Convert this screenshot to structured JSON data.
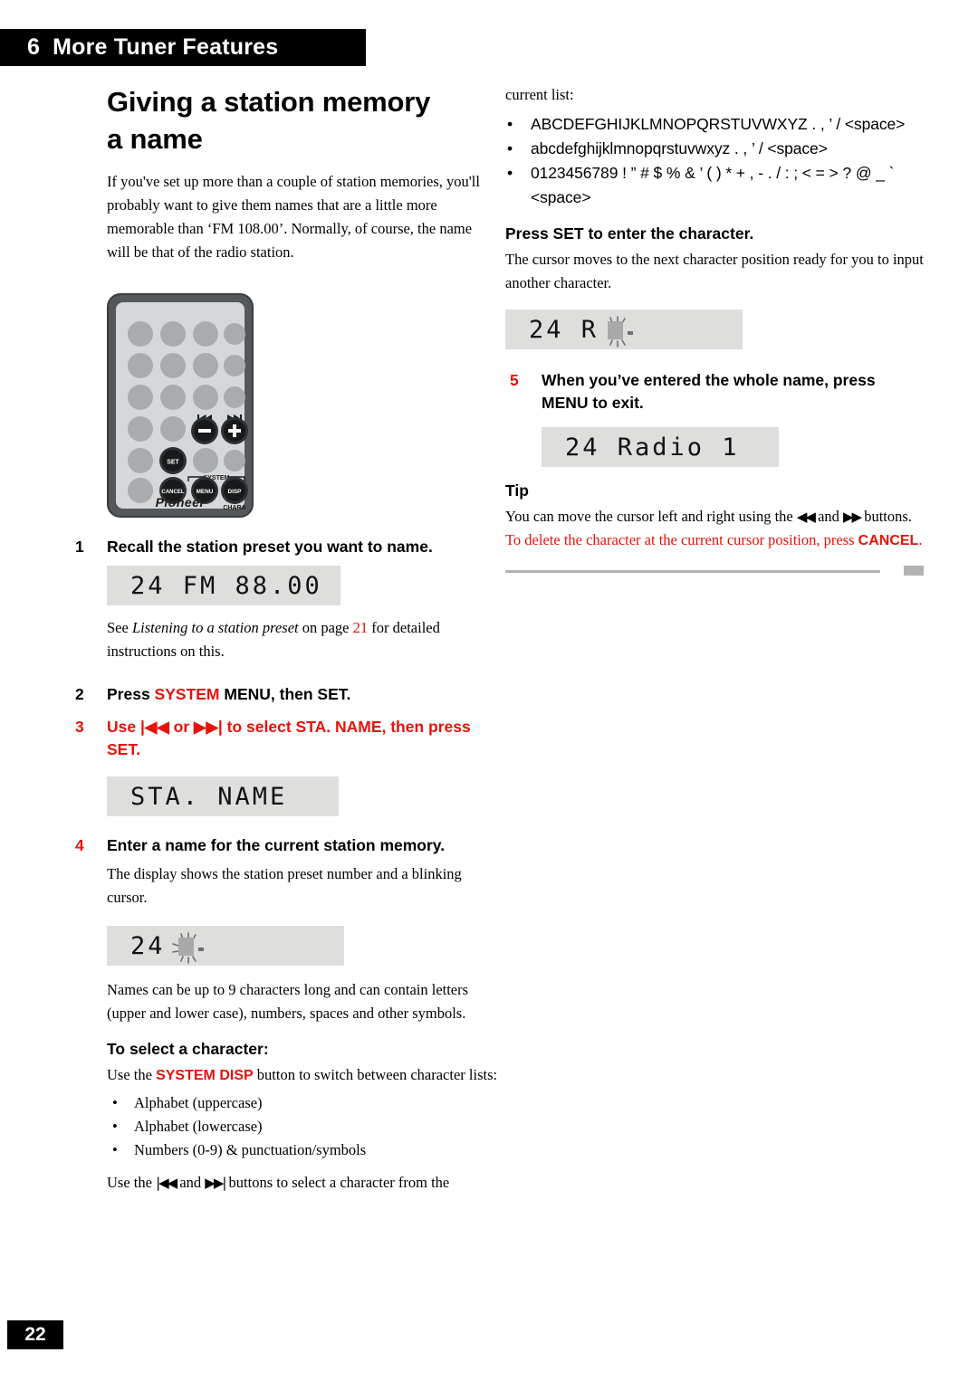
{
  "header": {
    "chapter_number": "6",
    "chapter_title": "More Tuner Features"
  },
  "page_number": "22",
  "left_column": {
    "section_title_line1": "Giving a station memory",
    "section_title_line2": "a name",
    "intro_paragraph": "If you've set up more than a couple of station memories, you'll probably want to give them names that are a little more memorable than ‘FM 108.00’. Normally, of course, the name will be that of the radio station.",
    "remote": {
      "brand": "Pioneer",
      "system_label": "SYSTEM",
      "chara_label": "CHARA",
      "button_set": "SET",
      "button_cancel": "CANCEL",
      "button_menu": "MENU",
      "button_disp": "DISP",
      "skip_back_label": "|◀◀",
      "skip_fwd_label": "▶▶|",
      "minus_label": "–",
      "plus_label": "+"
    },
    "step1": {
      "num": "1",
      "text": "Recall the station preset you want to name.",
      "lcd": "24 FM  88.00",
      "note_prefix": "See ",
      "note_italic": "Listening to a station preset",
      "note_middle": " on page ",
      "note_page": "21",
      "note_suffix": " for detailed instructions on this."
    },
    "step2": {
      "num": "2",
      "text_before": "Press ",
      "highlight": "SYSTEM",
      "text_after": " MENU, then SET."
    },
    "step3": {
      "num": "3",
      "text": "Use |◀◀ or ▶▶| to select STA. NAME, then press SET.",
      "lcd": "STA. NAME"
    },
    "step4": {
      "num": "4",
      "text": "Enter a name for the current station memory.",
      "note": "The display shows the station preset number and a blinking cursor.",
      "lcd_prefix": "24",
      "lcd_cursor": "blinking-cursor",
      "after_note": "Names can be up to 9 characters long and can contain letters (upper and lower case), numbers, spaces and other symbols."
    },
    "select_character": {
      "heading": "To select a character:",
      "intro_before": "Use the ",
      "intro_highlight": "SYSTEM DISP",
      "intro_after": " button to switch between character lists:",
      "items": [
        "Alphabet (uppercase)",
        "Alphabet (lowercase)",
        "Numbers (0-9) & punctuation/symbols"
      ],
      "footer_before": "Use the ",
      "footer_arrow1": "|◀◀",
      "footer_middle": " and ",
      "footer_arrow2": "▶▶|",
      "footer_after": " buttons to select a character from the"
    }
  },
  "right_column": {
    "continuation": "current list:",
    "char_lists": [
      "ABCDEFGHIJKLMNOPQRSTUVWXYZ . , ’ / <space>",
      "abcdefghijklmnopqrstuvwxyz . , ’ / <space>",
      "0123456789 ! ” # $ % & ’ ( ) * + , - . / : ; < = > ? @ _ ` <space>"
    ],
    "press_set": {
      "heading": "Press SET to enter the character.",
      "body": "The cursor moves to the next character position ready for you to input another character.",
      "lcd_prefix": "24 R",
      "lcd_cursor": "blinking-cursor"
    },
    "step5": {
      "num": "5",
      "text": "When you’ve entered the whole name, press MENU to exit.",
      "lcd": "24 Radio  1"
    },
    "tip": {
      "heading": "Tip",
      "body_before": "You can move the cursor left and right using the ",
      "arrow1": "◀◀",
      "body_middle": " and ",
      "arrow2": "▶▶",
      "body_after": " buttons. ",
      "red_text": "To delete the character at the current cursor position, press ",
      "red_bold": "CANCEL",
      "red_end": "."
    }
  },
  "colors": {
    "accent_red": "#e8120b",
    "lcd_background": "#dededd",
    "header_black": "#000000",
    "rule_gray": "#b3b3b3"
  }
}
